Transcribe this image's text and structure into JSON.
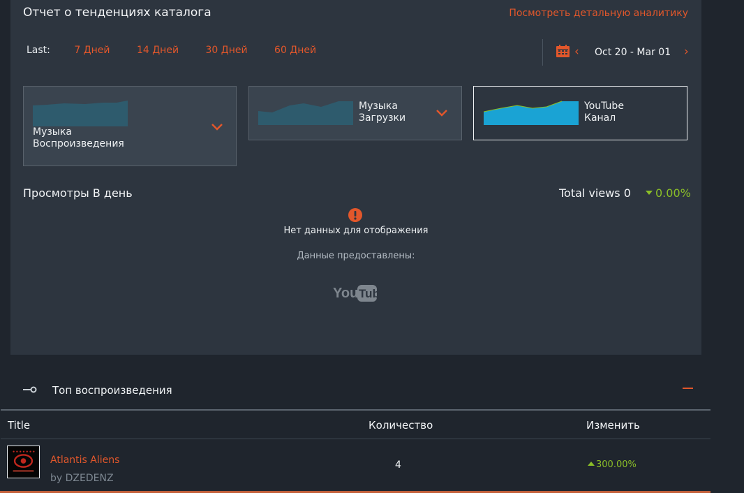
{
  "report": {
    "title": "Отчет о тенденциях каталога",
    "detail_link": "Посмотреть детальную аналитику",
    "range_label": "Last:",
    "ranges": [
      "7 Дней",
      "14 Дней",
      "30 Дней",
      "60 Дней"
    ],
    "date_range": "Oct 20 - Mar 01"
  },
  "cards": [
    {
      "label_line1": "Музыка",
      "label_line2": "Воспроизведения",
      "active": false
    },
    {
      "label_line1": "Музыка",
      "label_line2": "Загрузки",
      "active": false
    },
    {
      "label_line1": "YouTube",
      "label_line2": "Канал",
      "active": true
    }
  ],
  "views": {
    "title": "Просмотры В день",
    "total": "Total views 0",
    "change": "0.00%",
    "no_data": "Нет данных для отображения",
    "provided_by": "Данные предоставлены:",
    "provider_logo": "YouTube"
  },
  "top_plays": {
    "title": "Топ воспроизведения",
    "columns": [
      "Title",
      "Количество",
      "Изменить"
    ],
    "rows": [
      {
        "title": "Atlantis Aliens",
        "artist": "by DZEDENZ",
        "count": "4",
        "change": "300.00%"
      }
    ]
  },
  "colors": {
    "accent": "#e2572b",
    "positive": "#8bbf28",
    "panel": "#2d353f",
    "background": "#1f252d",
    "spark_active": "#1aa3d4",
    "spark_inactive": "#2e5b6d"
  },
  "icons": [
    "calendar-icon",
    "chevron-left-icon",
    "chevron-right-icon",
    "chevron-down-icon",
    "warning-icon",
    "youtube-logo",
    "connector-icon"
  ]
}
